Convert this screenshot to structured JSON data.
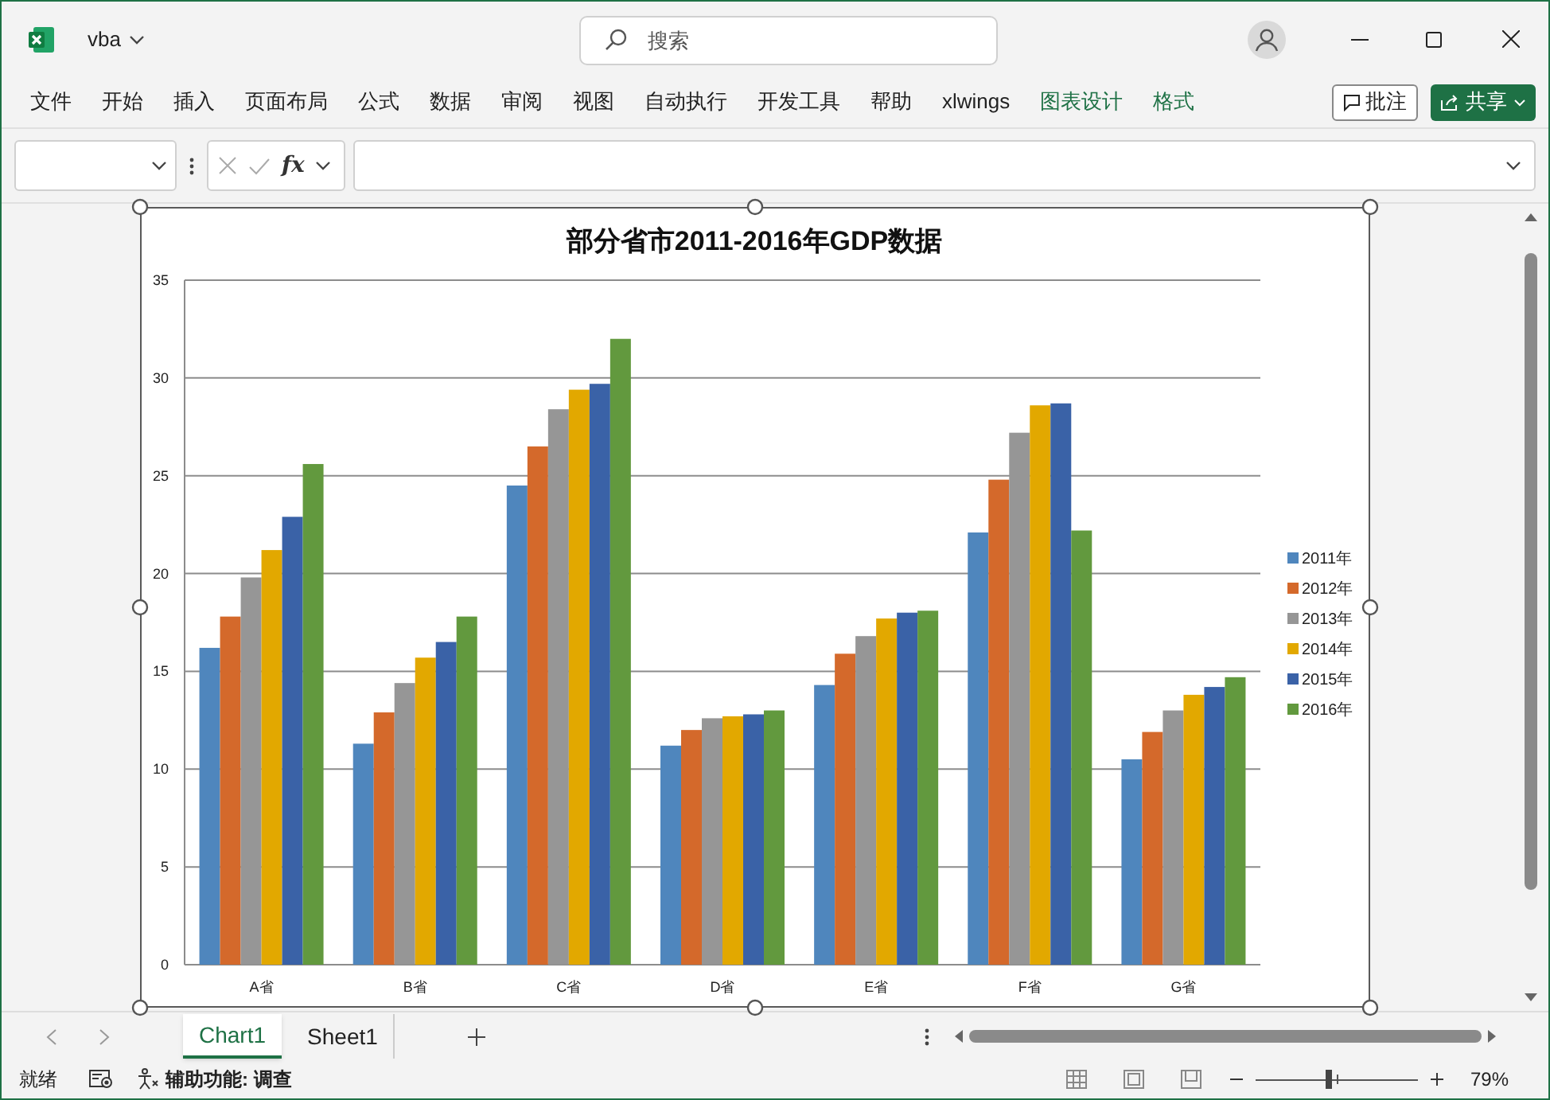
{
  "window": {
    "file_name": "vba",
    "search_placeholder": "搜索"
  },
  "ribbon_tabs": [
    {
      "label": "文件",
      "kind": "normal"
    },
    {
      "label": "开始",
      "kind": "normal"
    },
    {
      "label": "插入",
      "kind": "normal"
    },
    {
      "label": "页面布局",
      "kind": "normal"
    },
    {
      "label": "公式",
      "kind": "normal"
    },
    {
      "label": "数据",
      "kind": "normal"
    },
    {
      "label": "审阅",
      "kind": "normal"
    },
    {
      "label": "视图",
      "kind": "normal"
    },
    {
      "label": "自动执行",
      "kind": "normal"
    },
    {
      "label": "开发工具",
      "kind": "normal"
    },
    {
      "label": "帮助",
      "kind": "normal"
    },
    {
      "label": "xlwings",
      "kind": "normal"
    },
    {
      "label": "图表设计",
      "kind": "contextual"
    },
    {
      "label": "格式",
      "kind": "contextual"
    }
  ],
  "comment_button": "批注",
  "share_button": "共享",
  "formula_bar": {
    "function_label": "fx"
  },
  "chart": {
    "chart_data": {
      "type": "bar",
      "grid": true,
      "legend": true,
      "title": "部分省市2011-2016年GDP数据",
      "categories": [
        "A省",
        "B省",
        "C省",
        "D省",
        "E省",
        "F省",
        "G省"
      ],
      "ylim": [
        0,
        35
      ],
      "yticks": [
        0,
        5,
        10,
        15,
        20,
        25,
        30,
        35
      ],
      "series": [
        {
          "name": "2011年",
          "color": "#4f86bd",
          "values": [
            16.2,
            11.3,
            24.5,
            11.2,
            14.3,
            22.1,
            10.5
          ]
        },
        {
          "name": "2012年",
          "color": "#d4692b",
          "values": [
            17.8,
            12.9,
            26.5,
            12.0,
            15.9,
            24.8,
            11.9
          ]
        },
        {
          "name": "2013年",
          "color": "#969696",
          "values": [
            19.8,
            14.4,
            28.4,
            12.6,
            16.8,
            27.2,
            13.0
          ]
        },
        {
          "name": "2014年",
          "color": "#e2a800",
          "values": [
            21.2,
            15.7,
            29.4,
            12.7,
            17.7,
            28.6,
            13.8
          ]
        },
        {
          "name": "2015年",
          "color": "#3a62a7",
          "values": [
            22.9,
            16.5,
            29.7,
            12.8,
            18.0,
            28.7,
            14.2
          ]
        },
        {
          "name": "2016年",
          "color": "#62993e",
          "values": [
            25.6,
            17.8,
            32.0,
            13.0,
            18.1,
            22.2,
            14.7
          ]
        }
      ]
    }
  },
  "sheet_tabs": [
    {
      "label": "Chart1",
      "selected": true
    },
    {
      "label": "Sheet1",
      "selected": false
    }
  ],
  "status_bar": {
    "ready": "就绪",
    "accessibility": "辅助功能: 调查",
    "zoom": "79%",
    "zoom_slider": {
      "level": 0.45
    }
  }
}
